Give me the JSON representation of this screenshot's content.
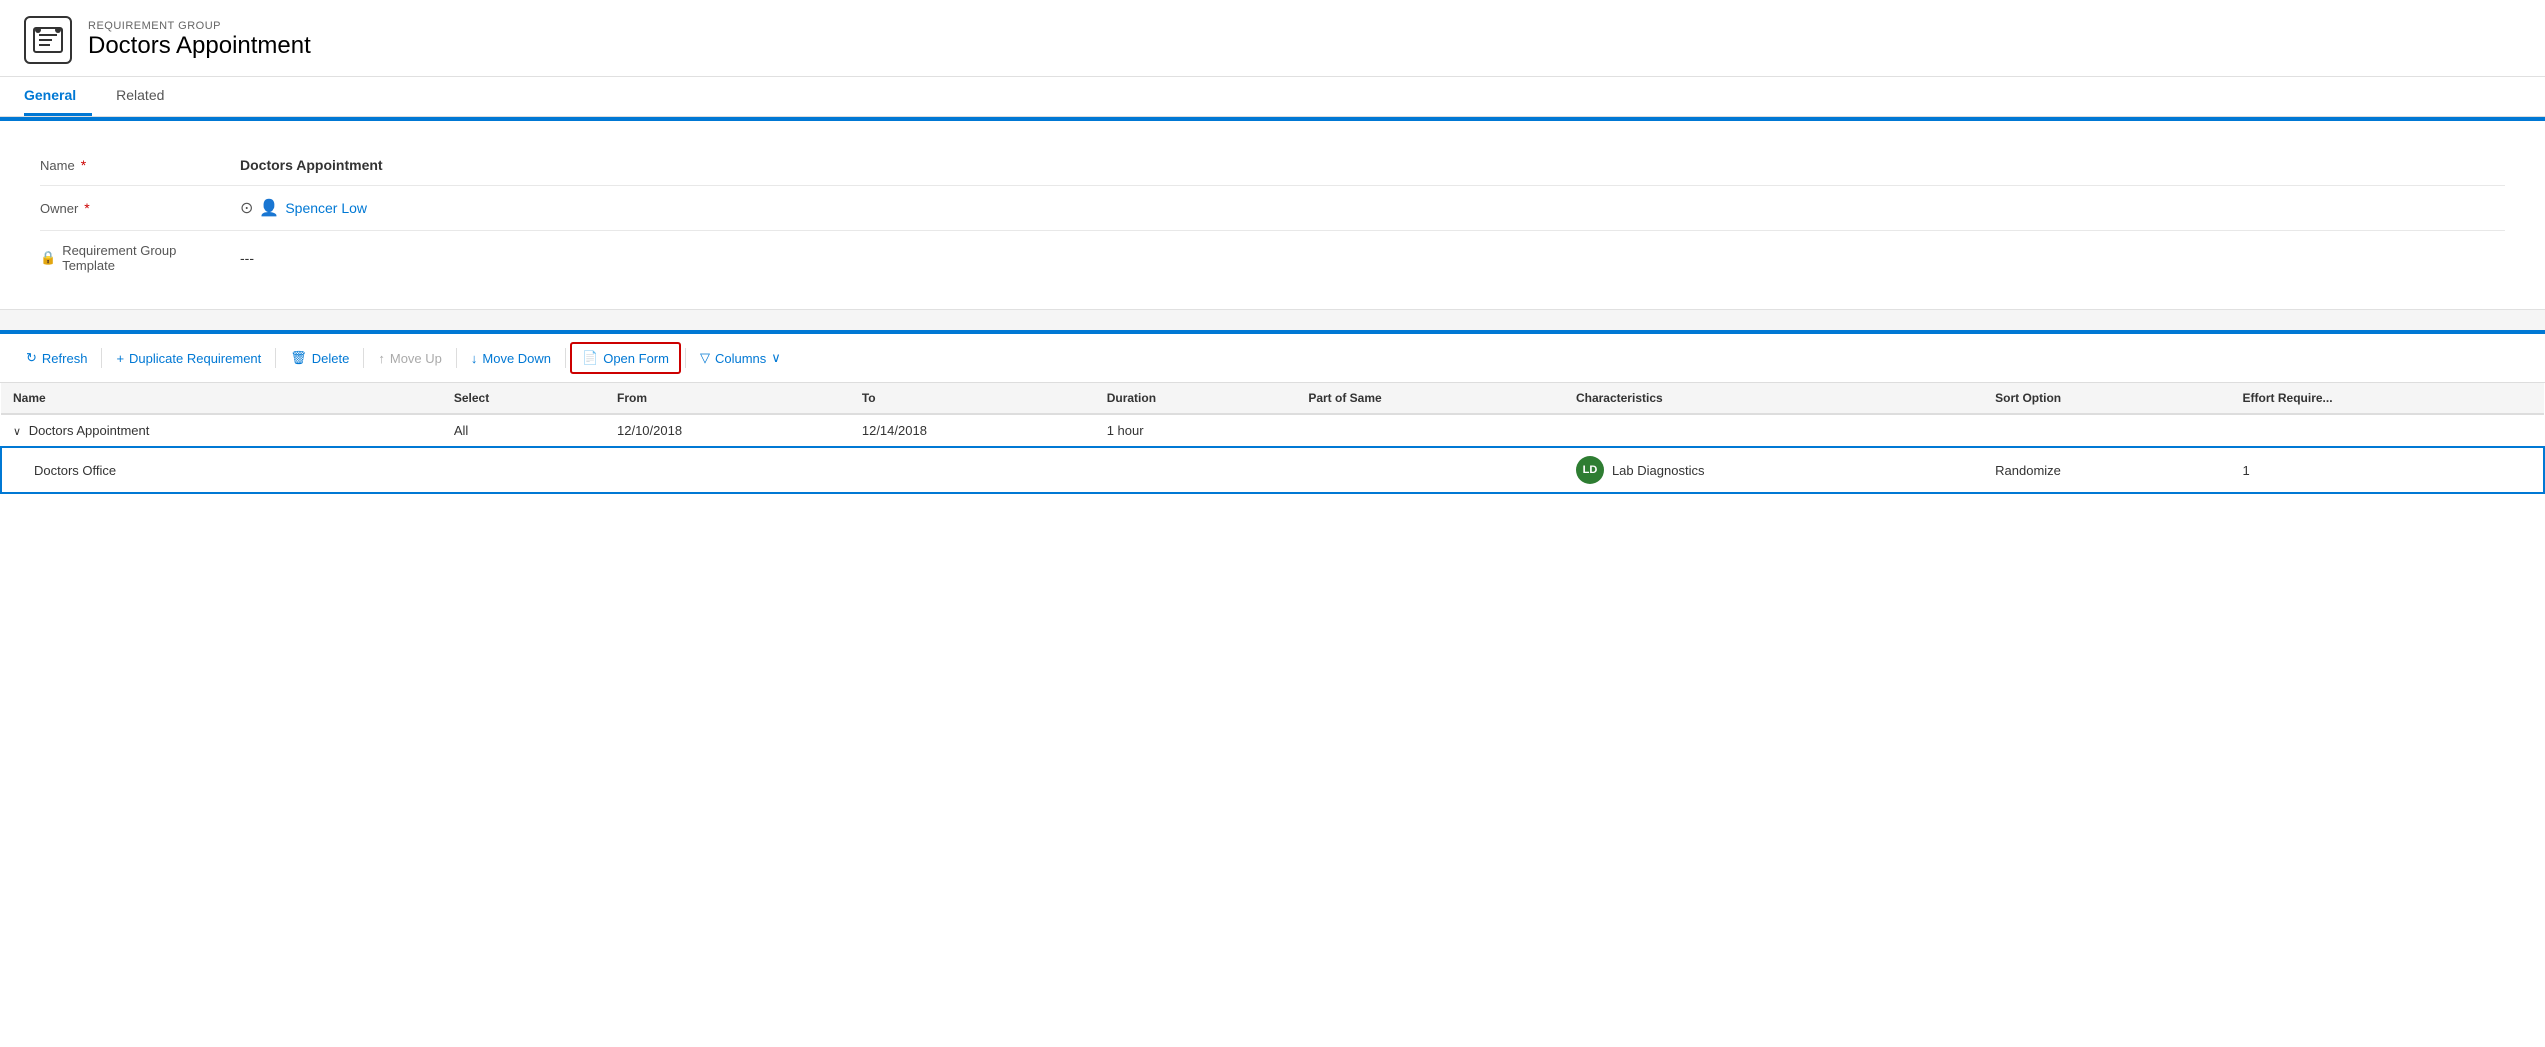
{
  "header": {
    "subtitle": "REQUIREMENT GROUP",
    "title": "Doctors Appointment",
    "icon": "📋"
  },
  "tabs": [
    {
      "label": "General",
      "active": true
    },
    {
      "label": "Related",
      "active": false
    }
  ],
  "form": {
    "fields": [
      {
        "label": "Name",
        "required": true,
        "value": "Doctors Appointment",
        "type": "bold",
        "lock": false
      },
      {
        "label": "Owner",
        "required": true,
        "value": "Spencer Low",
        "type": "link",
        "lock": false,
        "showIcons": true
      },
      {
        "label": "Requirement Group Template",
        "required": false,
        "value": "---",
        "type": "text",
        "lock": true
      }
    ]
  },
  "toolbar": {
    "buttons": [
      {
        "key": "refresh",
        "label": "Refresh",
        "icon": "↻",
        "disabled": false,
        "highlighted": false
      },
      {
        "key": "duplicate",
        "label": "Duplicate Requirement",
        "icon": "+",
        "disabled": false,
        "highlighted": false
      },
      {
        "key": "delete",
        "label": "Delete",
        "icon": "🗑",
        "disabled": false,
        "highlighted": false
      },
      {
        "key": "move-up",
        "label": "Move Up",
        "icon": "↑",
        "disabled": true,
        "highlighted": false
      },
      {
        "key": "move-down",
        "label": "Move Down",
        "icon": "↓",
        "disabled": false,
        "highlighted": false
      },
      {
        "key": "open-form",
        "label": "Open Form",
        "icon": "📄",
        "disabled": false,
        "highlighted": true
      },
      {
        "key": "columns",
        "label": "Columns",
        "icon": "▽",
        "disabled": false,
        "highlighted": false,
        "suffix": "∨"
      }
    ]
  },
  "table": {
    "columns": [
      {
        "key": "name",
        "label": "Name"
      },
      {
        "key": "select",
        "label": "Select"
      },
      {
        "key": "from",
        "label": "From"
      },
      {
        "key": "to",
        "label": "To"
      },
      {
        "key": "duration",
        "label": "Duration"
      },
      {
        "key": "partofsame",
        "label": "Part of Same"
      },
      {
        "key": "characteristics",
        "label": "Characteristics"
      },
      {
        "key": "sortoption",
        "label": "Sort Option"
      },
      {
        "key": "effortrequired",
        "label": "Effort Require..."
      }
    ],
    "rows": [
      {
        "name": "Doctors Appointment",
        "nameExpand": true,
        "select": "All",
        "from": "12/10/2018",
        "to": "12/14/2018",
        "duration": "1 hour",
        "partofsame": "",
        "characteristicsAvatar": "",
        "characteristicsLabel": "",
        "sortoption": "",
        "effortrequired": "",
        "isParent": true,
        "selected": false
      },
      {
        "name": "Doctors Office",
        "nameExpand": false,
        "select": "",
        "from": "",
        "to": "",
        "duration": "",
        "partofsame": "",
        "characteristicsAvatar": "LD",
        "characteristicsLabel": "Lab Diagnostics",
        "sortoption": "Randomize",
        "effortrequired": "1",
        "isParent": false,
        "selected": true
      }
    ]
  }
}
